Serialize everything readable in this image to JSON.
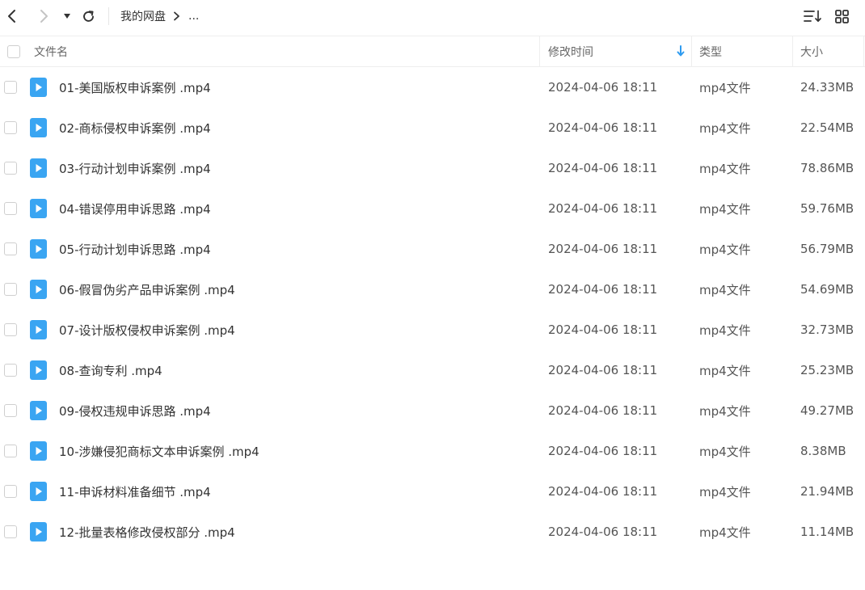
{
  "toolbar": {
    "back_icon": "chevron-left-icon",
    "forward_icon": "chevron-right-icon",
    "dropdown_icon": "caret-down-icon",
    "refresh_icon": "refresh-icon",
    "sort_icon": "sort-list-icon",
    "grid_icon": "grid-view-icon"
  },
  "breadcrumb": {
    "root": "我的网盘",
    "separator_icon": "chevron-right-icon",
    "more": "..."
  },
  "header": {
    "name": "文件名",
    "modified": "修改时间",
    "type": "类型",
    "size": "大小",
    "sort_direction": "descending",
    "sort_icon": "arrow-down-icon"
  },
  "colors": {
    "accent": "#2e9bf0",
    "file_icon": "#3aa5f2",
    "border": "#eeeeee"
  },
  "files": [
    {
      "name": "01-美国版权申诉案例 .mp4",
      "modified": "2024-04-06 18:11",
      "type": "mp4文件",
      "size": "24.33MB"
    },
    {
      "name": "02-商标侵权申诉案例 .mp4",
      "modified": "2024-04-06 18:11",
      "type": "mp4文件",
      "size": "22.54MB"
    },
    {
      "name": "03-行动计划申诉案例 .mp4",
      "modified": "2024-04-06 18:11",
      "type": "mp4文件",
      "size": "78.86MB"
    },
    {
      "name": "04-错误停用申诉思路 .mp4",
      "modified": "2024-04-06 18:11",
      "type": "mp4文件",
      "size": "59.76MB"
    },
    {
      "name": "05-行动计划申诉思路 .mp4",
      "modified": "2024-04-06 18:11",
      "type": "mp4文件",
      "size": "56.79MB"
    },
    {
      "name": "06-假冒伪劣产品申诉案例 .mp4",
      "modified": "2024-04-06 18:11",
      "type": "mp4文件",
      "size": "54.69MB"
    },
    {
      "name": "07-设计版权侵权申诉案例 .mp4",
      "modified": "2024-04-06 18:11",
      "type": "mp4文件",
      "size": "32.73MB"
    },
    {
      "name": "08-查询专利 .mp4",
      "modified": "2024-04-06 18:11",
      "type": "mp4文件",
      "size": "25.23MB"
    },
    {
      "name": "09-侵权违规申诉思路 .mp4",
      "modified": "2024-04-06 18:11",
      "type": "mp4文件",
      "size": "49.27MB"
    },
    {
      "name": "10-涉嫌侵犯商标文本申诉案例 .mp4",
      "modified": "2024-04-06 18:11",
      "type": "mp4文件",
      "size": "8.38MB"
    },
    {
      "name": "11-申诉材料准备细节 .mp4",
      "modified": "2024-04-06 18:11",
      "type": "mp4文件",
      "size": "21.94MB"
    },
    {
      "name": "12-批量表格修改侵权部分 .mp4",
      "modified": "2024-04-06 18:11",
      "type": "mp4文件",
      "size": "11.14MB"
    }
  ]
}
